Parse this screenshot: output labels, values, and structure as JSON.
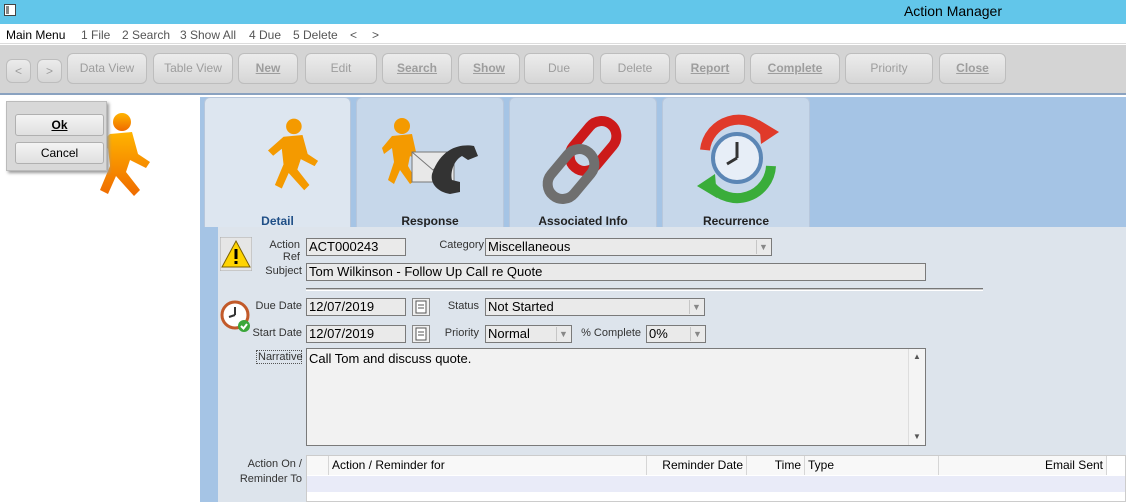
{
  "window": {
    "title": "Action Manager"
  },
  "menu": {
    "main": "Main Menu",
    "items": [
      "1 File",
      "2 Search",
      "3 Show All",
      "4 Due",
      "5 Delete",
      "<",
      ">"
    ]
  },
  "toolbar": {
    "back": "<",
    "forward": ">",
    "buttons": [
      "Data View",
      "Table View",
      "New",
      "Edit",
      "Search",
      "Show",
      "Due",
      "Delete",
      "Report",
      "Complete",
      "Priority",
      "Close"
    ]
  },
  "dialog": {
    "ok": "Ok",
    "cancel": "Cancel"
  },
  "tabs": [
    {
      "label": "Detail",
      "icon": "running-man-icon",
      "active": true
    },
    {
      "label": "Response",
      "icon": "response-email-phone-icon"
    },
    {
      "label": "Associated Info",
      "icon": "chain-link-icon"
    },
    {
      "label": "Recurrence",
      "icon": "recurrence-clock-icon"
    }
  ],
  "form": {
    "action_ref_label": "Action Ref",
    "action_ref": "ACT000243",
    "category_label": "Category",
    "category": "Miscellaneous",
    "subject_label": "Subject",
    "subject": "Tom Wilkinson - Follow Up Call re Quote",
    "due_date_label": "Due Date",
    "due_date": "12/07/2019",
    "start_date_label": "Start Date",
    "start_date": "12/07/2019",
    "status_label": "Status",
    "status": "Not Started",
    "priority_label": "Priority",
    "priority": "Normal",
    "complete_label": "% Complete",
    "complete": "0%",
    "narrative_label": "Narrative",
    "narrative": "Call Tom and discuss quote."
  },
  "reminders": {
    "label_line1": "Action On /",
    "label_line2": "Reminder To",
    "columns": [
      "Action / Reminder for",
      "Reminder Date",
      "Time",
      "Type",
      "Email Sent"
    ]
  }
}
